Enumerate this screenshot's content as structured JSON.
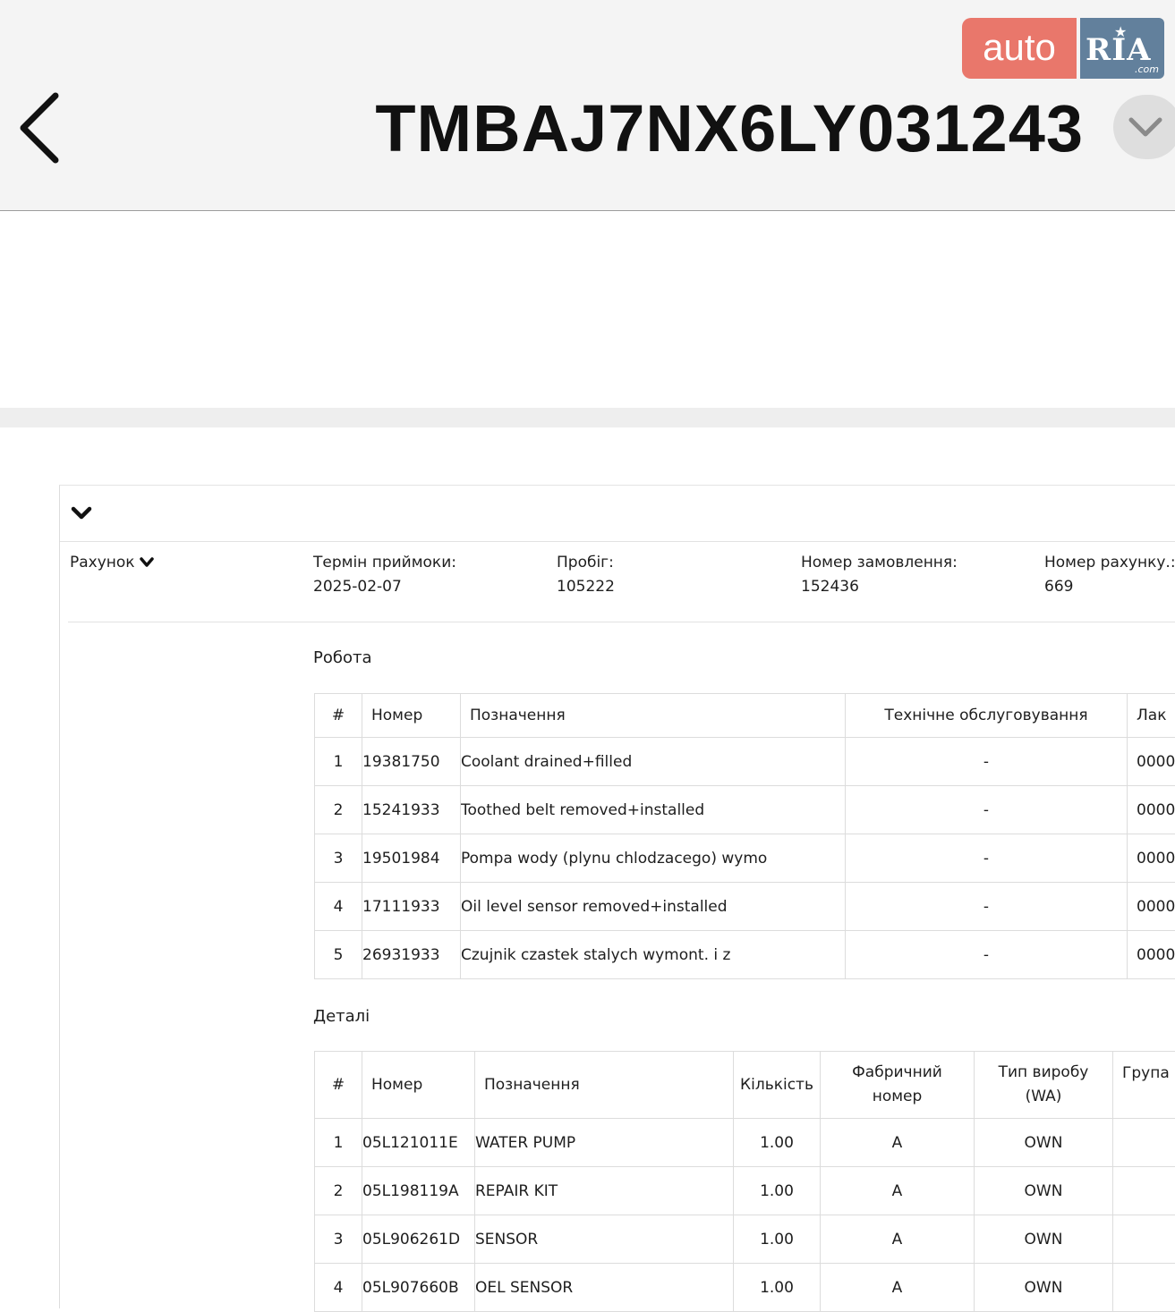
{
  "header": {
    "vin": "TMBAJ7NX6LY031243",
    "back_icon": "chevron-left-icon",
    "expand_icon": "chevron-down-icon",
    "logo": {
      "part1": "auto",
      "part2": "RIA",
      "suffix": ".com",
      "colors": {
        "auto_bg": "#e9776b",
        "ria_bg": "#62809c"
      }
    }
  },
  "invoice": {
    "toggle_label": "Рахунок",
    "fields": [
      {
        "label": "Термін приймоки:",
        "value": "2025-02-07"
      },
      {
        "label": "Пробіг:",
        "value": "105222"
      },
      {
        "label": "Номер замовлення:",
        "value": "152436"
      },
      {
        "label": "Номер рахунку.:",
        "value": "669"
      }
    ]
  },
  "work": {
    "title": "Робота",
    "columns": [
      "#",
      "Номер",
      "Позначення",
      "Технічне обслуговування",
      "Лак"
    ],
    "rows": [
      [
        "1",
        "19381750",
        "Coolant drained+filled",
        "-",
        "0000"
      ],
      [
        "2",
        "15241933",
        "Toothed belt removed+installed",
        "-",
        "0000"
      ],
      [
        "3",
        "19501984",
        "Pompa wody (plynu chlodzacego) wymo",
        "-",
        "0000"
      ],
      [
        "4",
        "17111933",
        "Oil level sensor removed+installed",
        "-",
        "0000"
      ],
      [
        "5",
        "26931933",
        "Czujnik czastek stalych wymont. i z",
        "-",
        "0000"
      ]
    ]
  },
  "parts": {
    "title": "Деталі",
    "columns": [
      "#",
      "Номер",
      "Позначення",
      "Кількість",
      "Фабричний номер",
      "Тип виробу (WA)",
      "Група"
    ],
    "rows": [
      [
        "1",
        "05L121011E",
        "WATER PUMP",
        "1.00",
        "A",
        "OWN",
        ""
      ],
      [
        "2",
        "05L198119A",
        "REPAIR KIT",
        "1.00",
        "A",
        "OWN",
        ""
      ],
      [
        "3",
        "05L906261D",
        "SENSOR",
        "1.00",
        "A",
        "OWN",
        ""
      ],
      [
        "4",
        "05L907660B",
        "OEL SENSOR",
        "1.00",
        "A",
        "OWN",
        ""
      ]
    ]
  }
}
